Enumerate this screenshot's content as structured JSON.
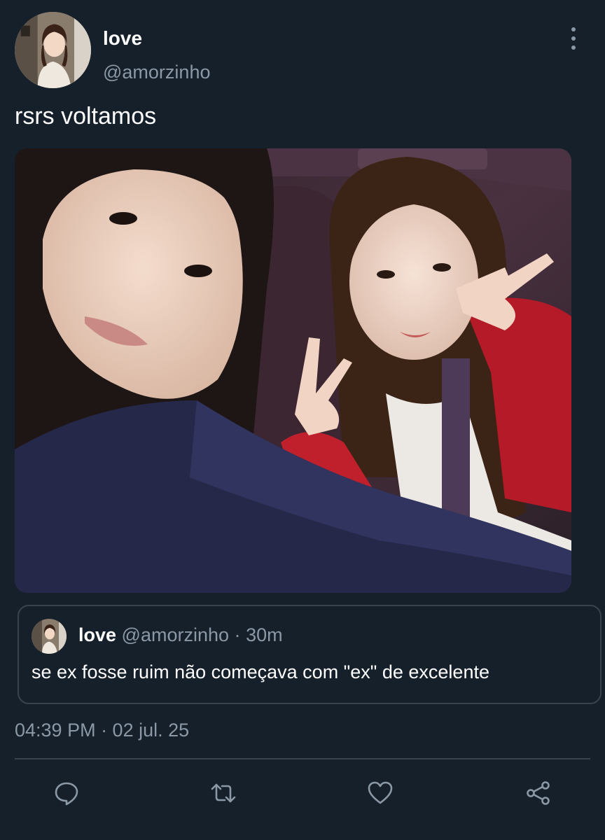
{
  "author": {
    "display_name": "love",
    "handle": "@amorzinho"
  },
  "tweet": {
    "text": "rsrs voltamos",
    "timestamp": "04:39 PM · 02 jul. 25"
  },
  "quote": {
    "display_name": "love",
    "handle": "@amorzinho",
    "separator": "·",
    "time": "30m",
    "text": "se ex fosse ruim não começava com \"ex\" de excelente"
  },
  "actions": {
    "reply_icon": "reply-icon",
    "retweet_icon": "retweet-icon",
    "like_icon": "heart-icon",
    "share_icon": "share-icon"
  },
  "colors": {
    "background": "#15202b",
    "text_primary": "#ffffff",
    "text_secondary": "#8b98a5",
    "border": "#38444d"
  }
}
